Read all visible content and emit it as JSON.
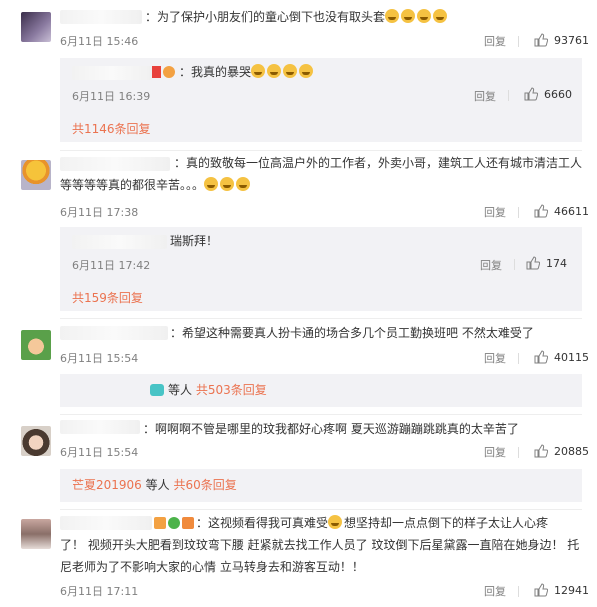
{
  "comments": [
    {
      "text": "：为了保护小朋友们的童心倒下也没有取头套",
      "emoji_count": 4,
      "time": "6月11日 15:46",
      "reply_label": "回复",
      "likes": "93761",
      "sub": {
        "text": "：我真的暴哭",
        "emoji_count": 4,
        "time": "6月11日 16:39",
        "reply_label": "回复",
        "likes": "6660"
      },
      "more": "共1146条回复"
    },
    {
      "text_line1": "：真的致敬每一位高温户外的工作者，外卖小哥，建筑工人还有城市清洁工人",
      "text_line2": "等等等等真的都很辛苦。。。",
      "emoji_count": 3,
      "time": "6月11日 17:38",
      "reply_label": "回复",
      "likes": "46611",
      "sub": {
        "text": "瑞斯拜！",
        "time": "6月11日 17:42",
        "reply_label": "回复",
        "likes": "174"
      },
      "more": "共159条回复"
    },
    {
      "text": "：希望这种需要真人扮卡通的场合多几个员工勤换班吧 不然太难受了",
      "time": "6月11日 15:54",
      "reply_label": "回复",
      "likes": "40115",
      "sub_summary": {
        "prefix": "等人",
        "more": "共503条回复"
      }
    },
    {
      "text": "：啊啊啊不管是哪里的玟我都好心疼啊 夏天巡游蹦蹦跳跳真的太辛苦了",
      "time": "6月11日 15:54",
      "reply_label": "回复",
      "likes": "20885",
      "sub_summary": {
        "name": "芒夏201906",
        "prefix": "等人",
        "more": "共60条回复"
      }
    },
    {
      "text_line1a": "：这视频看得我可真难受",
      "text_line1b": "想坚持却一点点倒下的样子太让人心疼",
      "text_line2": "了！ 视频开头大肥看到玟玟弯下腰 赶紧就去找工作人员了 玟玟倒下后星黛露一直陪在她身边！ 托",
      "text_line3": "尼老师为了不影响大家的心情 立马转身去和游客互动！！",
      "time": "6月11日 17:11",
      "reply_label": "回复",
      "likes": "12941"
    }
  ]
}
